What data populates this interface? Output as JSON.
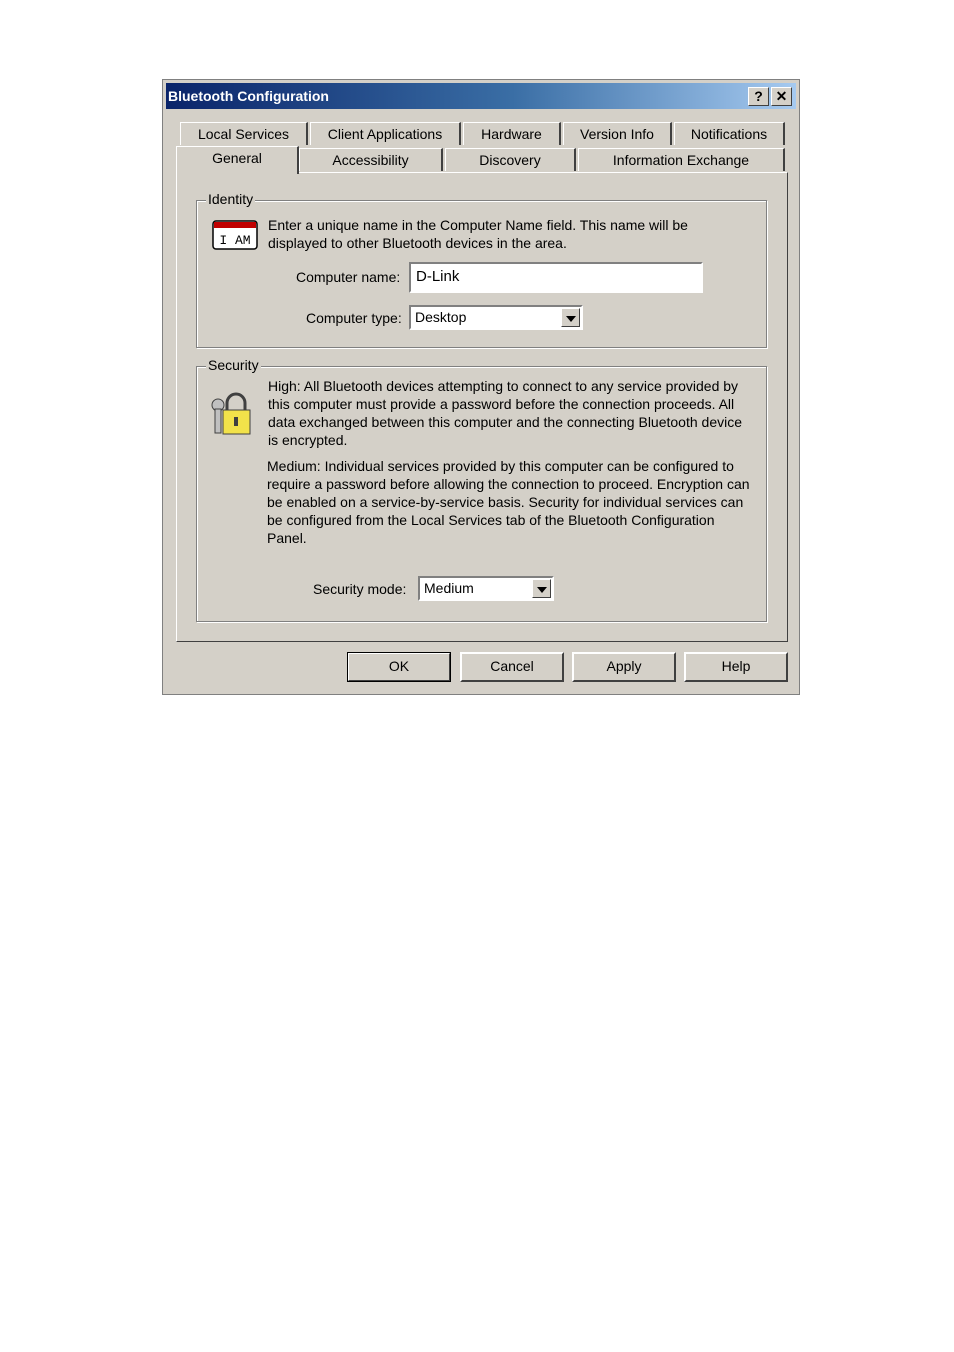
{
  "window": {
    "title": "Bluetooth Configuration",
    "help_label": "?",
    "close_label": "✕"
  },
  "tabs_back": [
    {
      "label": "Local Services"
    },
    {
      "label": "Client Applications"
    },
    {
      "label": "Hardware"
    },
    {
      "label": "Version Info"
    },
    {
      "label": "Notifications"
    }
  ],
  "tabs_front": [
    {
      "label": "General"
    },
    {
      "label": "Accessibility"
    },
    {
      "label": "Discovery"
    },
    {
      "label": "Information Exchange"
    }
  ],
  "identity": {
    "legend": "Identity",
    "description": "Enter a unique name in the Computer Name field. This name will be displayed to other Bluetooth devices in the area.",
    "computer_name_label": "Computer name:",
    "computer_name_value": "D-Link",
    "computer_type_label": "Computer type:",
    "computer_type_value": "Desktop",
    "icon": "i-am-badge-icon",
    "icon_text": "I AM"
  },
  "security": {
    "legend": "Security",
    "high_text": "High: All Bluetooth devices attempting to connect to any service provided by this computer must provide a password before the connection proceeds. All data exchanged between this computer and the connecting Bluetooth device is encrypted.",
    "medium_text": "Medium: Individual services provided by this computer can be configured to require a password before allowing the connection to proceed. Encryption can be enabled on a service-by-service basis. Security for individual services can be configured from the Local Services tab of the Bluetooth Configuration Panel.",
    "mode_label": "Security mode:",
    "mode_value": "Medium",
    "icon": "padlock-keys-icon"
  },
  "buttons": {
    "ok": "OK",
    "cancel": "Cancel",
    "apply": "Apply",
    "help": "Help"
  },
  "colors": {
    "titlebar_start": "#0a246a",
    "titlebar_end": "#a6caf0",
    "face": "#d4d0c8"
  }
}
